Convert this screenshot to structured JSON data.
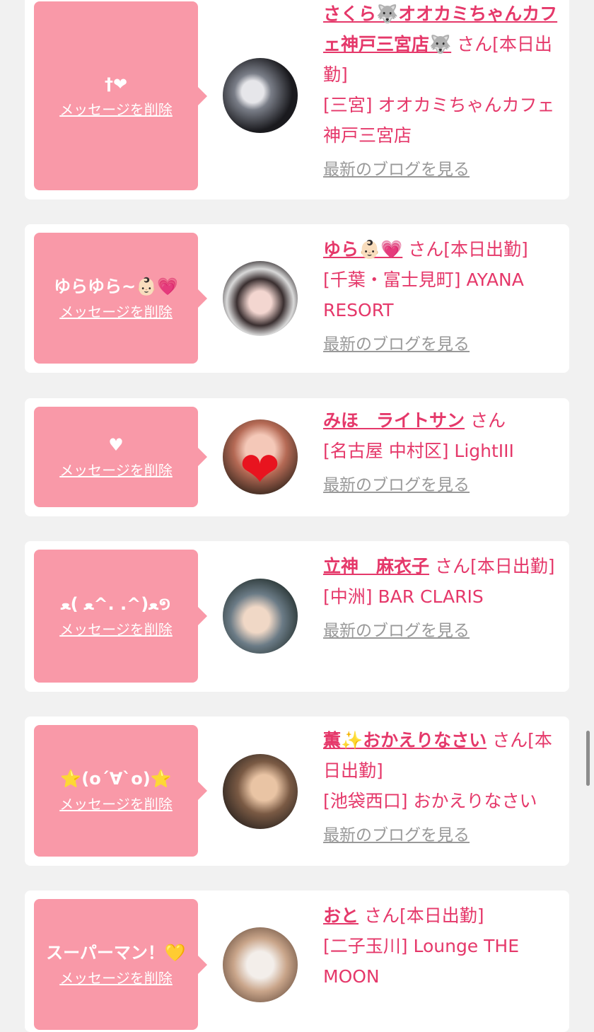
{
  "delete_label": "メッセージを削除",
  "blog_label": "最新のブログを見る",
  "suffix_san": "さん",
  "cards": [
    {
      "message": "†❤",
      "name": "さくら🐺オオカミちゃんカフェ神戸三宮店🐺",
      "status": "[本日出勤]",
      "area": "[三宮]",
      "shop": "オオカミちゃんカフェ神戸三宮店"
    },
    {
      "message": "ゆらゆら~👶🏻💗",
      "name": "ゆら👶🏻💗",
      "status": "[本日出勤]",
      "area": "[千葉・富士見町]",
      "shop": "AYANA RESORT"
    },
    {
      "message": "♥",
      "name": "みほ　ライトサン",
      "status": "",
      "area": "[名古屋 中村区]",
      "shop": "LightIII"
    },
    {
      "message": "ﻌ(^. .^ﻌ )ﻌ១",
      "name": "立神　麻衣子",
      "status": "[本日出勤]",
      "area": "[中洲]",
      "shop": "BAR CLARIS"
    },
    {
      "message": "⭐(o´∀`o)⭐",
      "name": "薫✨おかえりなさい",
      "status": "[本日出勤]",
      "area": "[池袋西口]",
      "shop": "おかえりなさい"
    },
    {
      "message": "スーパーマン！💛",
      "name": "おと",
      "status": "[本日出勤]",
      "area": "[二子玉川]",
      "shop": "Lounge THE MOON"
    }
  ]
}
